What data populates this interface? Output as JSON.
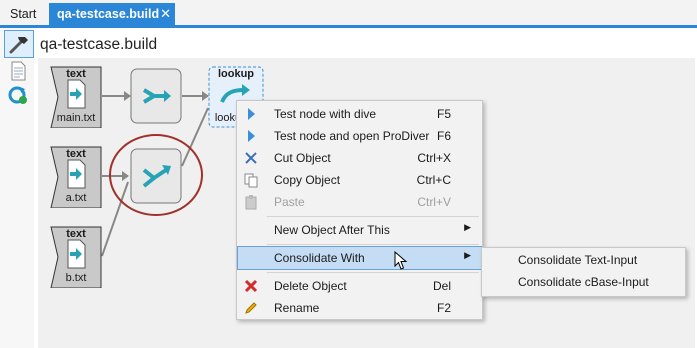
{
  "tabs": {
    "start": "Start",
    "active": "qa-testcase.build",
    "close": "✕"
  },
  "document": {
    "title": "qa-testcase.build"
  },
  "toolbar_icons": [
    "hammer-icon",
    "document-icon",
    "refresh-icon"
  ],
  "nodes": [
    {
      "id": "text1",
      "title": "text",
      "label": "main.txt",
      "icon": "file-icon"
    },
    {
      "id": "text2",
      "title": "text",
      "label": "a.txt",
      "icon": "file-icon"
    },
    {
      "id": "text3",
      "title": "text",
      "label": "b.txt",
      "icon": "file-icon"
    },
    {
      "id": "merge1",
      "title": "",
      "label": "",
      "icon": "merge-icon"
    },
    {
      "id": "merge2",
      "title": "",
      "label": "",
      "icon": "merge-icon",
      "highlighted": true
    },
    {
      "id": "lookup",
      "title": "lookup",
      "label": "looku",
      "icon": "lookup-icon",
      "selected": true
    }
  ],
  "context_menu": {
    "items": [
      {
        "label": "Test node with dive",
        "shortcut": "F5",
        "icon": "play-icon"
      },
      {
        "label": "Test node and open ProDiver",
        "shortcut": "F6",
        "icon": "play-icon"
      },
      {
        "label": "Cut Object",
        "shortcut": "Ctrl+X",
        "icon": "scissors-icon"
      },
      {
        "label": "Copy Object",
        "shortcut": "Ctrl+C",
        "icon": "copy-icon"
      },
      {
        "label": "Paste",
        "shortcut": "Ctrl+V",
        "icon": "paste-icon",
        "disabled": true
      },
      {
        "label": "New Object After This",
        "shortcut": "",
        "submenu": true
      },
      {
        "label": "Consolidate With",
        "shortcut": "",
        "submenu": true,
        "highlighted": true
      },
      {
        "label": "Delete Object",
        "shortcut": "Del",
        "icon": "delete-icon"
      },
      {
        "label": "Rename",
        "shortcut": "F2",
        "icon": "pencil-icon"
      }
    ]
  },
  "submenu": {
    "items": [
      {
        "label": "Consolidate Text-Input"
      },
      {
        "label": "Consolidate cBase-Input"
      }
    ]
  },
  "colors": {
    "accent": "#2b86d8",
    "highlight_ring": "#a0302a",
    "node_teal": "#27a3b5",
    "menu_highlight": "#c4dcf4"
  }
}
